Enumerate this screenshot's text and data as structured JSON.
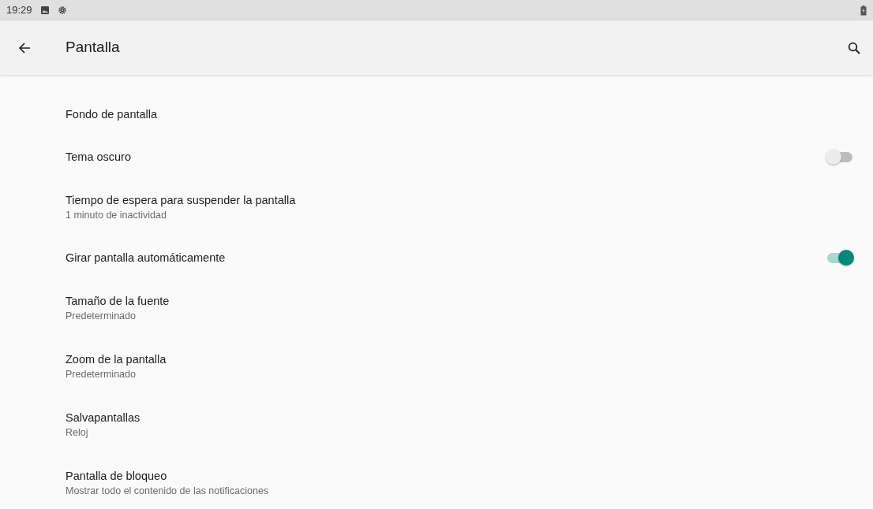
{
  "status_bar": {
    "time": "19:29"
  },
  "app_bar": {
    "title": "Pantalla"
  },
  "settings": [
    {
      "kind": "plain",
      "title": "Fondo de pantalla"
    },
    {
      "kind": "switch",
      "title": "Tema oscuro",
      "on": false
    },
    {
      "kind": "plain",
      "title": "Tiempo de espera para suspender la pantalla",
      "summary": "1 minuto de inactividad"
    },
    {
      "kind": "switch",
      "title": "Girar pantalla automáticamente",
      "on": true
    },
    {
      "kind": "plain",
      "title": "Tamaño de la fuente",
      "summary": "Predeterminado"
    },
    {
      "kind": "plain",
      "title": "Zoom de la pantalla",
      "summary": "Predeterminado"
    },
    {
      "kind": "plain",
      "title": "Salvapantallas",
      "summary": "Reloj"
    },
    {
      "kind": "plain",
      "title": "Pantalla de bloqueo",
      "summary": "Mostrar todo el contenido de las notificaciones"
    }
  ]
}
